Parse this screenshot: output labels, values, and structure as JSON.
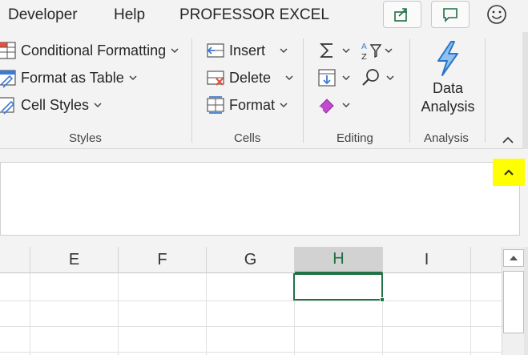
{
  "menu": {
    "items": [
      "Developer",
      "Help",
      "PROFESSOR EXCEL"
    ]
  },
  "ribbon": {
    "styles": {
      "conditional_formatting": "Conditional Formatting",
      "format_as_table": "Format as Table",
      "cell_styles": "Cell Styles",
      "label": "Styles"
    },
    "cells": {
      "insert": "Insert",
      "delete": "Delete",
      "format": "Format",
      "label": "Cells"
    },
    "editing": {
      "label": "Editing"
    },
    "analysis": {
      "data_analysis_line1": "Data",
      "data_analysis_line2": "Analysis",
      "label": "Analysis"
    }
  },
  "grid": {
    "columns": [
      "E",
      "F",
      "G",
      "H",
      "I"
    ],
    "selected_column": "H"
  },
  "colors": {
    "accent_green": "#217346",
    "highlight_yellow": "#ffff00",
    "ribbon_bg": "#f3f3f3"
  },
  "icons": [
    "share-icon",
    "comment-icon",
    "smiley-icon",
    "autosum-icon",
    "sort-filter-icon",
    "fill-icon",
    "find-icon",
    "clear-icon",
    "data-analysis-icon",
    "collapse-ribbon-icon",
    "collapse-formula-bar-icon"
  ]
}
